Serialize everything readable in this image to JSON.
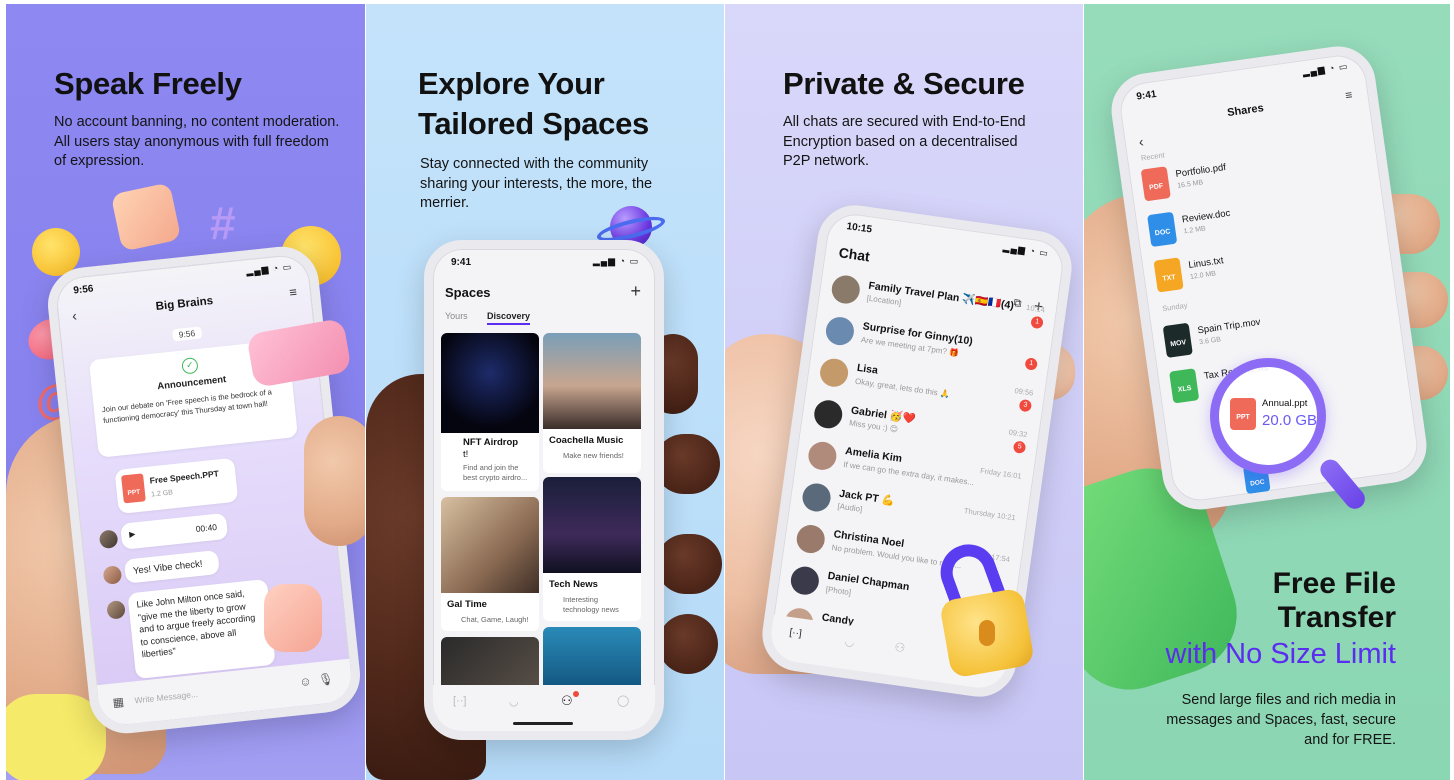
{
  "panel1": {
    "title": "Speak Freely",
    "subtitle": "No account banning, no content moderation. All users stay anonymous with full freedom of expression.",
    "phone": {
      "time": "9:56",
      "header": "Big Brains",
      "timestamp": "9:56",
      "announcement_title": "Announcement",
      "announcement_text": "Join our debate on 'Free speech is the bedrock of a functioning democracy' this Thursday at town hall!",
      "file_name": "Free Speech.PPT",
      "file_size": "1.2 GB",
      "file_badge": "PPT",
      "voice_duration": "00:40",
      "msg1": "Yes! Vibe check!",
      "msg2": "Like John Milton once said, \"give me the liberty to grow and to argue freely according to conscience, above all liberties\"",
      "input_placeholder": "Write Message..."
    }
  },
  "panel2": {
    "title_line1": "Explore Your",
    "title_line2": "Tailored Spaces",
    "subtitle": "Stay connected with the community sharing your interests, the more, the merrier.",
    "phone": {
      "time": "9:41",
      "header": "Spaces",
      "tab_yours": "Yours",
      "tab_discovery": "Discovery",
      "cards": [
        {
          "title": "NFT Airdrop",
          "sub": "t!",
          "desc": "Find and join the best crypto airdro..."
        },
        {
          "title": "Coachella Music",
          "desc": "Make new friends!"
        },
        {
          "title": "Gal Time",
          "desc": "Chat, Game, Laugh!"
        },
        {
          "title": "Tech News",
          "desc": "Interesting technology news"
        }
      ]
    }
  },
  "panel3": {
    "title": "Private & Secure",
    "subtitle": "All chats are secured with End-to-End Encryption based on a decentralised P2P network.",
    "phone": {
      "time": "10:15",
      "header": "Chat",
      "chats": [
        {
          "name": "Family Travel Plan ✈️🇪🇸🇫🇷(4)",
          "msg": "[Location]",
          "time": "10:14",
          "badge": "1"
        },
        {
          "name": "Surprise for Ginny(10)",
          "msg": "Are we meeting at 7pm? 🎁",
          "time": "",
          "badge": "1"
        },
        {
          "name": "Lisa",
          "msg": "Okay, great, lets do this 🙏",
          "time": "09:56",
          "badge": "3"
        },
        {
          "name": "Gabriel 🥳❤️",
          "msg": "Miss you :) 😊",
          "time": "09:32",
          "badge": "5"
        },
        {
          "name": "Amelia Kim",
          "msg": "If we can go the extra day, it makes...",
          "time": "Friday 16:01",
          "badge": ""
        },
        {
          "name": "Jack PT 💪",
          "msg": "[Audio]",
          "time": "Thursday 10:21",
          "badge": ""
        },
        {
          "name": "Christina Noel",
          "msg": "No problem. Would you like to reco...",
          "time": "Tuesday 17:54",
          "badge": ""
        },
        {
          "name": "Daniel Chapman",
          "msg": "[Photo]",
          "time": "",
          "badge": ""
        },
        {
          "name": "Candy",
          "msg": "",
          "time": "",
          "badge": ""
        }
      ]
    }
  },
  "panel4": {
    "title_line1": "Free File",
    "title_line2": "Transfer",
    "title_line3": "with No Size Limit",
    "subtitle": "Send large files and rich media in messages and Spaces, fast, secure and for FREE.",
    "accent": "#5a2df0",
    "phone": {
      "time": "9:41",
      "header": "Shares",
      "section_recent": "Recent",
      "section_sunday": "Sunday",
      "files": [
        {
          "name": "Portfolio.pdf",
          "size": "16.5 MB",
          "badge": "PDF",
          "color": "#f06a5a"
        },
        {
          "name": "Review.doc",
          "size": "1.2 MB",
          "badge": "DOC",
          "color": "#2f8fe8"
        },
        {
          "name": "Linus.txt",
          "size": "12.0 MB",
          "badge": "TXT",
          "color": "#f5a623"
        },
        {
          "name": "Spain Trip.mov",
          "size": "3.6 GB",
          "badge": "MOV",
          "color": "#1d2a2a"
        },
        {
          "name": "Tax Returns.xls",
          "size": "",
          "badge": "XLS",
          "color": "#3fb85a"
        }
      ],
      "magnified_name": "Annual.ppt",
      "magnified_size": "20.0 GB",
      "magnified_badge": "PPT",
      "bottom_badge": "DOC"
    }
  }
}
